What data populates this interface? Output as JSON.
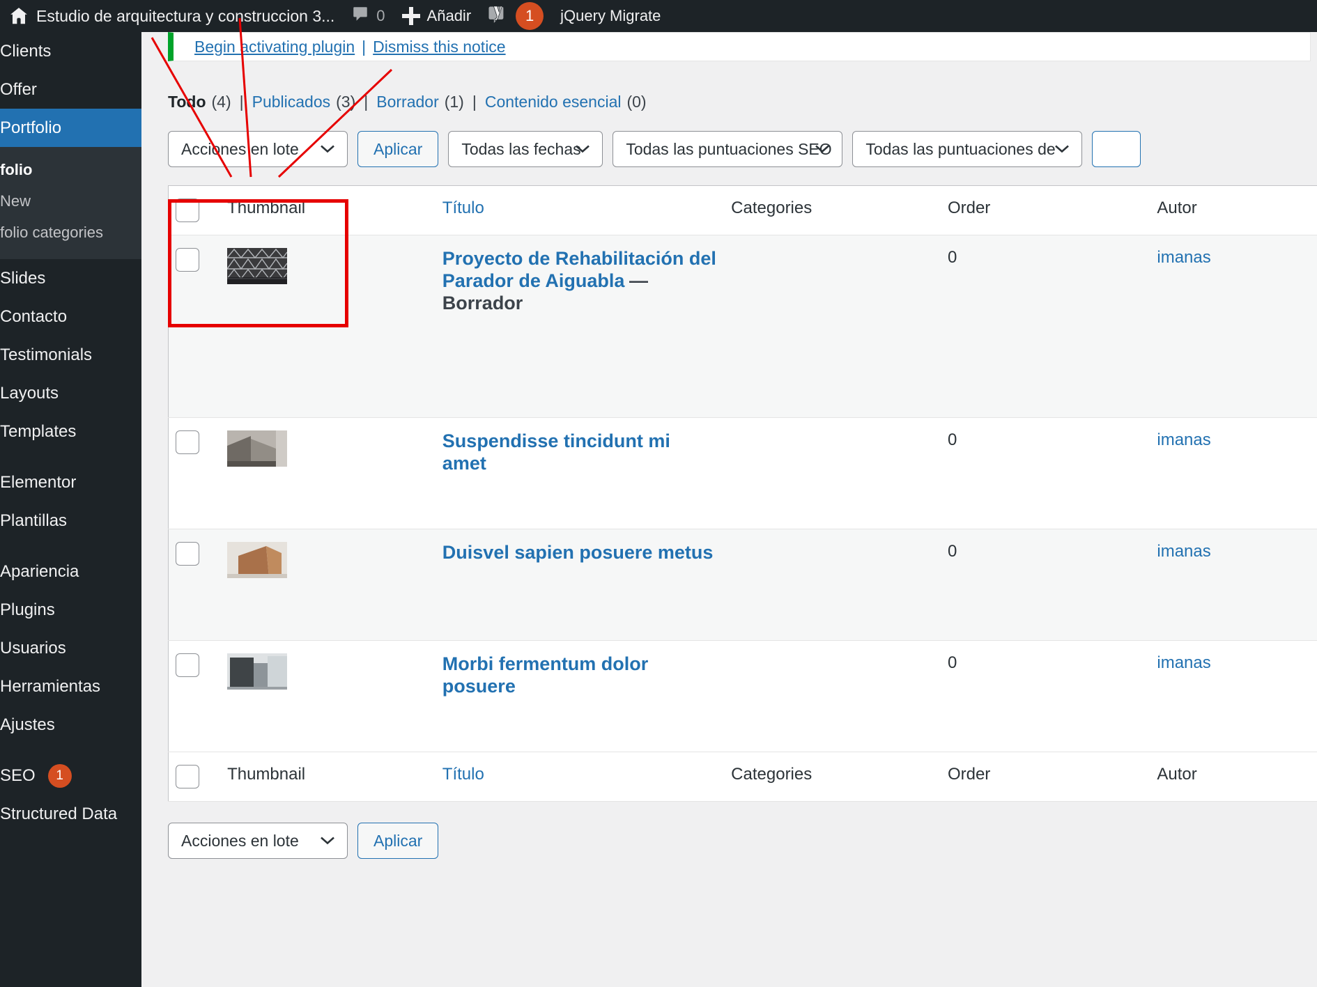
{
  "adminbar": {
    "home_icon": "wordpress-home-icon",
    "site_name": "Estudio de arquitectura y construccion 3...",
    "comments_icon": "comment-bubble-icon",
    "comments_count": "0",
    "new_icon": "plus-icon",
    "new_label": "Añadir",
    "yoast_icon": "yoast-seo-icon",
    "yoast_count": "1",
    "jquery_migrate_label": "jQuery Migrate"
  },
  "sidebar": {
    "items": [
      {
        "label": "Clients",
        "state": "normal"
      },
      {
        "label": "Offer",
        "state": "normal"
      },
      {
        "label": "Portfolio",
        "state": "current"
      }
    ],
    "submenu": [
      {
        "label": "folio",
        "state": "current"
      },
      {
        "label": "New",
        "state": "normal"
      },
      {
        "label": "folio categories",
        "state": "normal"
      }
    ],
    "items2": [
      {
        "label": "Slides"
      },
      {
        "label": "Contacto"
      },
      {
        "label": "Testimonials"
      },
      {
        "label": "Layouts"
      },
      {
        "label": "Templates"
      }
    ],
    "items3": [
      {
        "label": "Elementor"
      },
      {
        "label": "Plantillas"
      }
    ],
    "items4": [
      {
        "label": "Apariencia"
      },
      {
        "label": "Plugins"
      },
      {
        "label": "Usuarios"
      },
      {
        "label": "Herramientas"
      },
      {
        "label": "Ajustes"
      }
    ],
    "seo": {
      "label": "SEO",
      "badge": "1"
    },
    "structured_data": {
      "label": "Structured Data"
    }
  },
  "notice": {
    "begin_activating": "Begin activating plugin",
    "separator": "|",
    "dismiss": "Dismiss this notice"
  },
  "views": [
    {
      "label": "Todo",
      "count": "(4)",
      "current": true
    },
    {
      "label": "Publicados",
      "count": "(3)",
      "current": false
    },
    {
      "label": "Borrador",
      "count": "(1)",
      "current": false
    },
    {
      "label": "Contenido esencial",
      "count": "(0)",
      "current": false
    }
  ],
  "tablenav_top": {
    "bulk_action": "Acciones en lote",
    "apply": "Aplicar",
    "date_filter": "Todas las fechas",
    "seo_filter": "Todas las puntuaciones SEO",
    "readability_filter": "Todas las puntuaciones de"
  },
  "tablenav_bottom": {
    "bulk_action": "Acciones en lote",
    "apply": "Aplicar"
  },
  "table": {
    "columns": {
      "thumbnail": "Thumbnail",
      "title": "Título",
      "categories": "Categories",
      "order": "Order",
      "author": "Autor"
    },
    "rows": [
      {
        "thumbnail": "portfolio-thumbnail-lattice-dome",
        "title": "Proyecto de Rehabilitación del Parador de Aiguabla",
        "post_state": "— Borrador",
        "categories": "",
        "order": "0",
        "author": "imanas"
      },
      {
        "thumbnail": "portfolio-thumbnail-building-corner",
        "title": "Suspendisse tincidunt mi amet",
        "post_state": "",
        "categories": "",
        "order": "0",
        "author": "imanas"
      },
      {
        "thumbnail": "portfolio-thumbnail-wood-structure",
        "title": "Duisvel sapien posuere metus",
        "post_state": "",
        "categories": "",
        "order": "0",
        "author": "imanas"
      },
      {
        "thumbnail": "portfolio-thumbnail-facade",
        "title": "Morbi fermentum dolor posuere",
        "post_state": "",
        "categories": "",
        "order": "0",
        "author": "imanas"
      }
    ]
  },
  "annotation": {
    "highlight_color": "#e60000",
    "target": "thumbnail-column-first-row"
  },
  "colors": {
    "admin_bar": "#1d2327",
    "sidebar": "#1d2327",
    "sidebar_current": "#2271b1",
    "link": "#2271b1",
    "notice_accent": "#00a32a",
    "badge": "#d54e21",
    "annotation": "#e60000"
  }
}
